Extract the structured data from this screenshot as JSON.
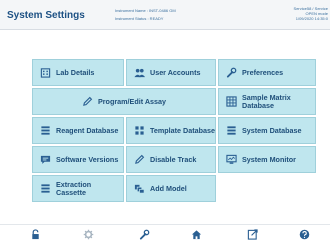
{
  "header": {
    "title": "System Settings",
    "instrument_name": "Instrument Name : INST-0486 GM",
    "instrument_status": "Instrument Status : READY",
    "right_line1": "Service58 / Service",
    "right_line2": "OPEN mode",
    "right_line3": "1/09/2020 14:35:0"
  },
  "tiles": {
    "lab_details": "Lab Details",
    "user_accounts": "User Accounts",
    "preferences": "Preferences",
    "program_edit_assay": "Program/Edit Assay",
    "sample_matrix_database": "Sample Matrix Database",
    "reagent_database": "Reagent Database",
    "template_database": "Template Database",
    "system_database": "System Database",
    "software_versions": "Software Versions",
    "disable_track": "Disable Track",
    "system_monitor": "System Monitor",
    "extraction_cassette": "Extraction Cassette",
    "add_model": "Add Model"
  },
  "colors": {
    "tile_background": "#bfe6ee",
    "text_primary": "#1f4f7a",
    "nav_icon": "#2a5f92"
  },
  "icons": {
    "lab_details": "building-icon",
    "user_accounts": "users-icon",
    "preferences": "wrench-icon",
    "program_edit_assay": "pencil-icon",
    "sample_matrix_database": "grid-icon",
    "reagent_database": "list-icon",
    "template_database": "template-grid-icon",
    "system_database": "list-icon",
    "software_versions": "chat-bubble-icon",
    "disable_track": "pencil-icon",
    "system_monitor": "monitor-icon",
    "extraction_cassette": "list-icon",
    "add_model": "models-icon",
    "bottom_nav": [
      "lock-icon",
      "gear-icon",
      "wrench-icon",
      "home-icon",
      "export-icon",
      "help-icon"
    ]
  }
}
